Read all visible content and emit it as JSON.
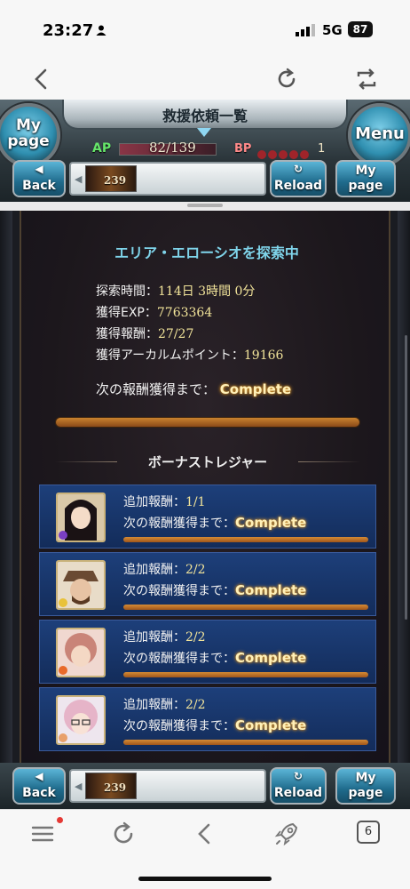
{
  "status_bar": {
    "time": "23:27",
    "network": "5G",
    "battery": "87"
  },
  "header": {
    "title": "救援依頼一覧",
    "mypage_line1": "My",
    "mypage_line2": "page",
    "menu_label": "Menu",
    "ap_label": "AP",
    "ap_value": "82/139",
    "bp_label": "BP",
    "bp_value": "1"
  },
  "nav": {
    "back_label": "Back",
    "thumb_number": "239",
    "reload_label": "Reload",
    "mypage_line1": "My",
    "mypage_line2": "page"
  },
  "explore": {
    "area_title": "エリア・エローシオを探索中",
    "time_label": "探索時間：",
    "time_value": "114日 3時間 0分",
    "exp_label": "獲得EXP：",
    "exp_value": "7763364",
    "reward_label": "獲得報酬：",
    "reward_value": "27/27",
    "arcarum_label": "獲得アーカルムポイント：",
    "arcarum_value": "19166",
    "next_label": "次の報酬獲得まで：",
    "next_value": "Complete",
    "progress": 1.0
  },
  "bonus": {
    "title": "ボーナストレジャー",
    "items": [
      {
        "label": "追加報酬：",
        "value": "1/1",
        "next_label": "次の報酬獲得まで：",
        "next_value": "Complete",
        "progress": 1.0
      },
      {
        "label": "追加報酬：",
        "value": "2/2",
        "next_label": "次の報酬獲得まで：",
        "next_value": "Complete",
        "progress": 1.0
      },
      {
        "label": "追加報酬：",
        "value": "2/2",
        "next_label": "次の報酬獲得まで：",
        "next_value": "Complete",
        "progress": 1.0
      },
      {
        "label": "追加報酬：",
        "value": "2/2",
        "next_label": "次の報酬獲得まで：",
        "next_value": "Complete",
        "progress": 1.0
      }
    ]
  },
  "browser": {
    "tabs_count": "6"
  },
  "colors": {
    "accent_cyan": "#7fd4ea",
    "value_yellow": "#f2e49a",
    "card_blue": "#1d3f7a",
    "progress_orange": "#c9822f"
  }
}
